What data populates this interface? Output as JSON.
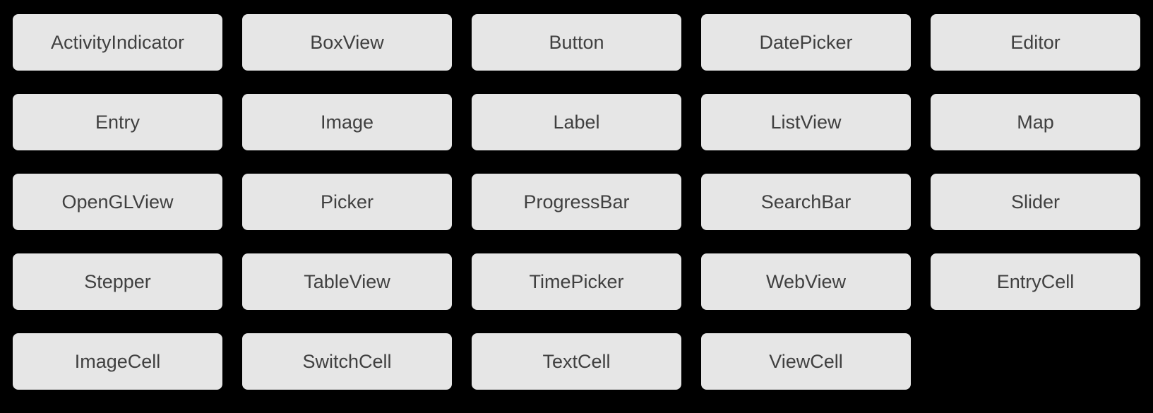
{
  "controls": [
    {
      "label": "ActivityIndicator",
      "name": "activity-indicator-tile"
    },
    {
      "label": "BoxView",
      "name": "box-view-tile"
    },
    {
      "label": "Button",
      "name": "button-tile"
    },
    {
      "label": "DatePicker",
      "name": "date-picker-tile"
    },
    {
      "label": "Editor",
      "name": "editor-tile"
    },
    {
      "label": "Entry",
      "name": "entry-tile"
    },
    {
      "label": "Image",
      "name": "image-tile"
    },
    {
      "label": "Label",
      "name": "label-tile"
    },
    {
      "label": "ListView",
      "name": "list-view-tile"
    },
    {
      "label": "Map",
      "name": "map-tile"
    },
    {
      "label": "OpenGLView",
      "name": "opengl-view-tile"
    },
    {
      "label": "Picker",
      "name": "picker-tile"
    },
    {
      "label": "ProgressBar",
      "name": "progress-bar-tile"
    },
    {
      "label": "SearchBar",
      "name": "search-bar-tile"
    },
    {
      "label": "Slider",
      "name": "slider-tile"
    },
    {
      "label": "Stepper",
      "name": "stepper-tile"
    },
    {
      "label": "TableView",
      "name": "table-view-tile"
    },
    {
      "label": "TimePicker",
      "name": "time-picker-tile"
    },
    {
      "label": "WebView",
      "name": "web-view-tile"
    },
    {
      "label": "EntryCell",
      "name": "entry-cell-tile"
    },
    {
      "label": "ImageCell",
      "name": "image-cell-tile"
    },
    {
      "label": "SwitchCell",
      "name": "switch-cell-tile"
    },
    {
      "label": "TextCell",
      "name": "text-cell-tile"
    },
    {
      "label": "ViewCell",
      "name": "view-cell-tile"
    }
  ]
}
